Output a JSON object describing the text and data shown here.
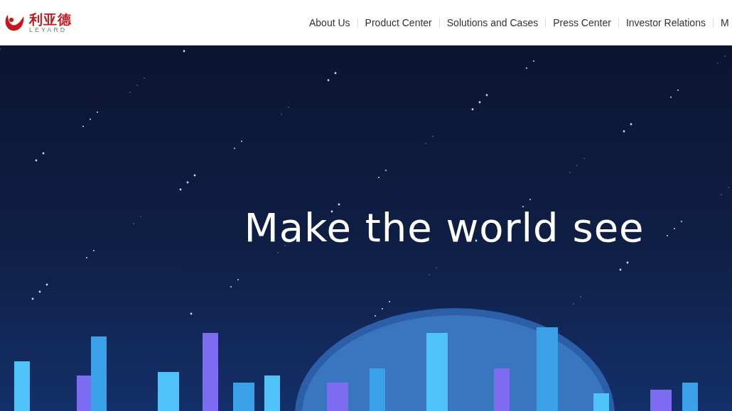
{
  "header": {
    "logo": {
      "chinese": "利亚德",
      "latin": "LEYARD"
    },
    "nav": [
      {
        "label": "About Us"
      },
      {
        "label": "Product Center"
      },
      {
        "label": "Solutions and Cases"
      },
      {
        "label": "Press Center"
      },
      {
        "label": "Investor Relations"
      },
      {
        "label": "M"
      }
    ]
  },
  "hero": {
    "headline": "Make the world see"
  }
}
